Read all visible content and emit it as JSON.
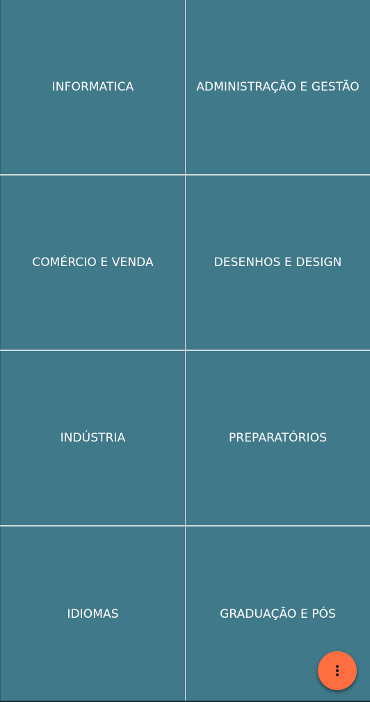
{
  "categories": [
    {
      "label": "INFORMATICA"
    },
    {
      "label": "ADMINISTRAÇÃO E GESTÃO"
    },
    {
      "label": "COMÉRCIO E VENDA"
    },
    {
      "label": "DESENHOS E DESIGN"
    },
    {
      "label": "INDÚSTRIA"
    },
    {
      "label": "PREPARATÓRIOS"
    },
    {
      "label": "IDIOMAS"
    },
    {
      "label": "GRADUAÇÃO E PÓS"
    }
  ],
  "fab": {
    "icon": "more-vert-icon"
  },
  "colors": {
    "tile": "#407989",
    "fab": "#ff6e40",
    "text": "#ffffff"
  }
}
